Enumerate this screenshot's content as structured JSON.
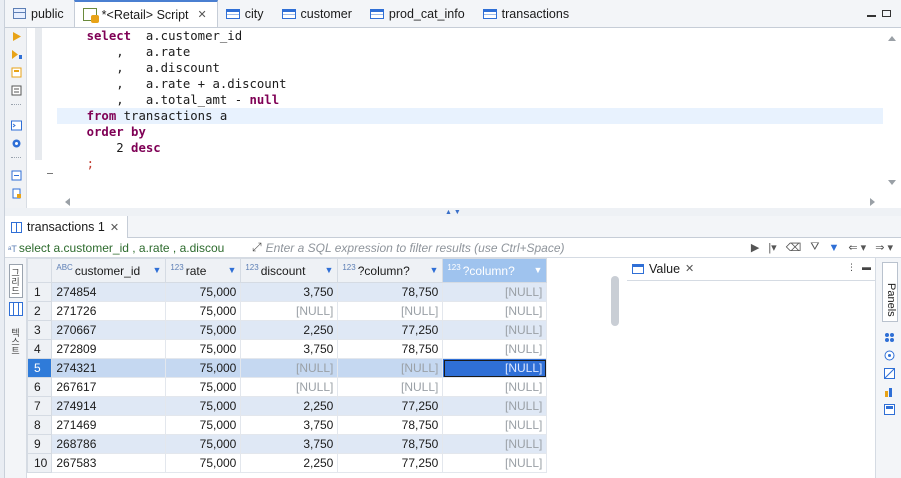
{
  "tabs": [
    {
      "label": "public",
      "icon": "database-icon",
      "active": false
    },
    {
      "label": "*<Retail> Script",
      "icon": "sql-script-icon",
      "active": true
    },
    {
      "label": "city",
      "icon": "table-icon",
      "active": false
    },
    {
      "label": "customer",
      "icon": "table-icon",
      "active": false
    },
    {
      "label": "prod_cat_info",
      "icon": "table-icon",
      "active": false
    },
    {
      "label": "transactions",
      "icon": "table-icon",
      "active": false
    }
  ],
  "editor": {
    "lines": [
      {
        "kw": "select",
        "rest": "  a.customer_id"
      },
      {
        "kw": "",
        "rest": "    ,   a.rate"
      },
      {
        "kw": "",
        "rest": "    ,   a.discount"
      },
      {
        "kw": "",
        "rest": "    ,   a.rate + a.discount"
      },
      {
        "kw": "",
        "rest": "    ,   a.total_amt - ",
        "tail_kw": "null"
      },
      {
        "kw": "from",
        "rest": " transactions a"
      },
      {
        "kw": "order by",
        "rest": ""
      },
      {
        "kw": "",
        "rest": "    2 ",
        "tail_kw": "desc"
      },
      {
        "kw": "",
        "rest": "    ;"
      }
    ]
  },
  "results": {
    "tab_label": "transactions 1",
    "query_text": "select a.customer_id , a.rate , a.discou",
    "filter_placeholder": "Enter a SQL expression to filter results (use Ctrl+Space)",
    "columns": [
      {
        "type": "ABC",
        "name": "customer_id"
      },
      {
        "type": "123",
        "name": "rate"
      },
      {
        "type": "123",
        "name": "discount"
      },
      {
        "type": "123",
        "name": "?column?"
      },
      {
        "type": "123",
        "name": "?column?"
      }
    ],
    "rows": [
      [
        "1",
        "274854",
        "75,000",
        "3,750",
        "78,750",
        "[NULL]"
      ],
      [
        "2",
        "271726",
        "75,000",
        "[NULL]",
        "[NULL]",
        "[NULL]"
      ],
      [
        "3",
        "270667",
        "75,000",
        "2,250",
        "77,250",
        "[NULL]"
      ],
      [
        "4",
        "272809",
        "75,000",
        "3,750",
        "78,750",
        "[NULL]"
      ],
      [
        "5",
        "274321",
        "75,000",
        "[NULL]",
        "[NULL]",
        "[NULL]"
      ],
      [
        "6",
        "267617",
        "75,000",
        "[NULL]",
        "[NULL]",
        "[NULL]"
      ],
      [
        "7",
        "274914",
        "75,000",
        "2,250",
        "77,250",
        "[NULL]"
      ],
      [
        "8",
        "271469",
        "75,000",
        "3,750",
        "78,750",
        "[NULL]"
      ],
      [
        "9",
        "268786",
        "75,000",
        "3,750",
        "78,750",
        "[NULL]"
      ],
      [
        "10",
        "267583",
        "75,000",
        "2,250",
        "77,250",
        "[NULL]"
      ]
    ],
    "selected_row": 5
  },
  "value_panel": {
    "label": "Value"
  },
  "side_labels": {
    "panels": "Panels",
    "grid": "그리드",
    "text": "텍스트"
  },
  "colors": {
    "accent": "#2f6fd6",
    "keyword": "#7f0055",
    "row_stripe": "#dfe8f5"
  }
}
